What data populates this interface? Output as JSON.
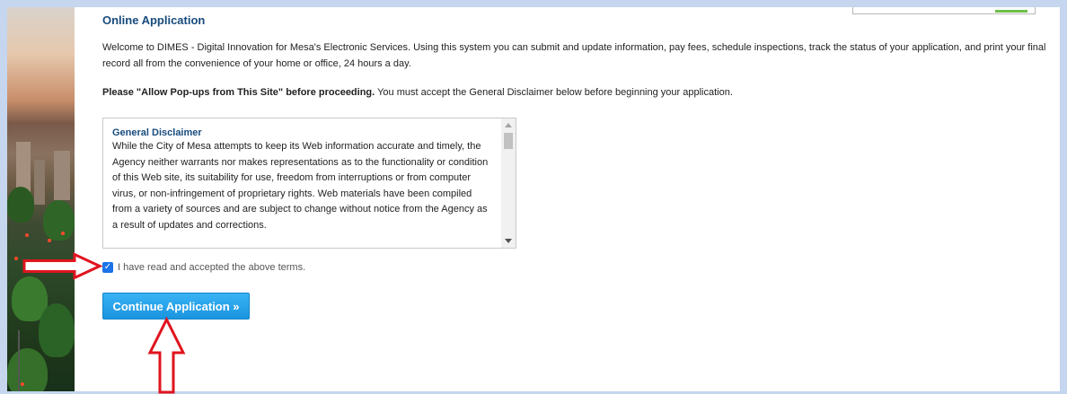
{
  "page": {
    "section_title": "Online Application",
    "welcome_text": "Welcome to DIMES - Digital Innovation for Mesa's Electronic Services. Using this system you can submit and update information, pay fees, schedule inspections, track the status of your application, and print your final record all from the convenience of your home or office, 24 hours a day.",
    "popups_bold": "Please \"Allow Pop-ups from This Site\" before proceeding.",
    "popups_rest": " You must accept the General Disclaimer below before beginning your application."
  },
  "disclaimer": {
    "title": "General Disclaimer",
    "body": "While the City of Mesa attempts to keep its Web information accurate and timely, the Agency neither warrants nor makes representations as to the functionality or condition of this Web site, its suitability for use, freedom from interruptions or from computer virus, or non-infringement of proprietary rights. Web materials have been compiled from a variety of sources and are subject to change without notice from the Agency as a result of updates and corrections."
  },
  "accept": {
    "checked": true,
    "check_glyph": "✓",
    "label": "I have read and accepted the above terms."
  },
  "actions": {
    "continue_label": "Continue Application »"
  },
  "colors": {
    "title_blue": "#184b7d",
    "button_blue": "#1a94de",
    "annotation_red": "#e0141e",
    "frame": "#c5d6ee"
  },
  "icons": {
    "right_arrow": "red-right-arrow-icon",
    "up_arrow": "red-up-arrow-icon"
  }
}
